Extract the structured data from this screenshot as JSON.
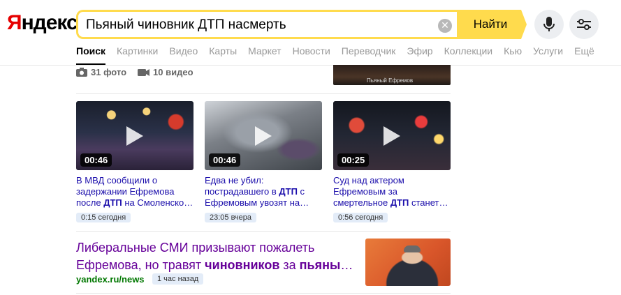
{
  "header": {
    "logo_first": "Я",
    "logo_rest": "ндекс",
    "search_value": "Пьяный чиновник ДТП насмерть",
    "clear_icon": "✕",
    "find_label": "Найти",
    "accent": "#ffdb4d"
  },
  "nav": {
    "items": [
      "Поиск",
      "Картинки",
      "Видео",
      "Карты",
      "Маркет",
      "Новости",
      "Переводчик",
      "Эфир",
      "Коллекции",
      "Кью",
      "Услуги",
      "Ещё"
    ]
  },
  "media": {
    "photos": "31 фото",
    "videos": "10 видео"
  },
  "top_thumb_watermark": "Пьяный Ефремов",
  "videos": [
    {
      "duration": "00:46",
      "title_parts": [
        "В МВД сообщили о задержании Ефремова после ",
        "ДТП",
        " на Смоленско…"
      ],
      "time": "0:15 сегодня"
    },
    {
      "duration": "00:46",
      "title_parts": [
        "Едва не убил: пострадавшего в ",
        "ДТП",
        " с Ефремовым увозят на…"
      ],
      "time": "23:05 вчера"
    },
    {
      "duration": "00:25",
      "title_parts": [
        "Суд над актером Ефремовым за смертельное ",
        "ДТП",
        " станет…"
      ],
      "time": "0:56 сегодня"
    }
  ],
  "news": {
    "title_parts": [
      "Либеральные СМИ призывают пожалеть Ефремова, но травят ",
      "чиновников",
      " за ",
      "пьяны",
      "…"
    ],
    "source": "yandex.ru/news",
    "time": "1 час назад"
  }
}
